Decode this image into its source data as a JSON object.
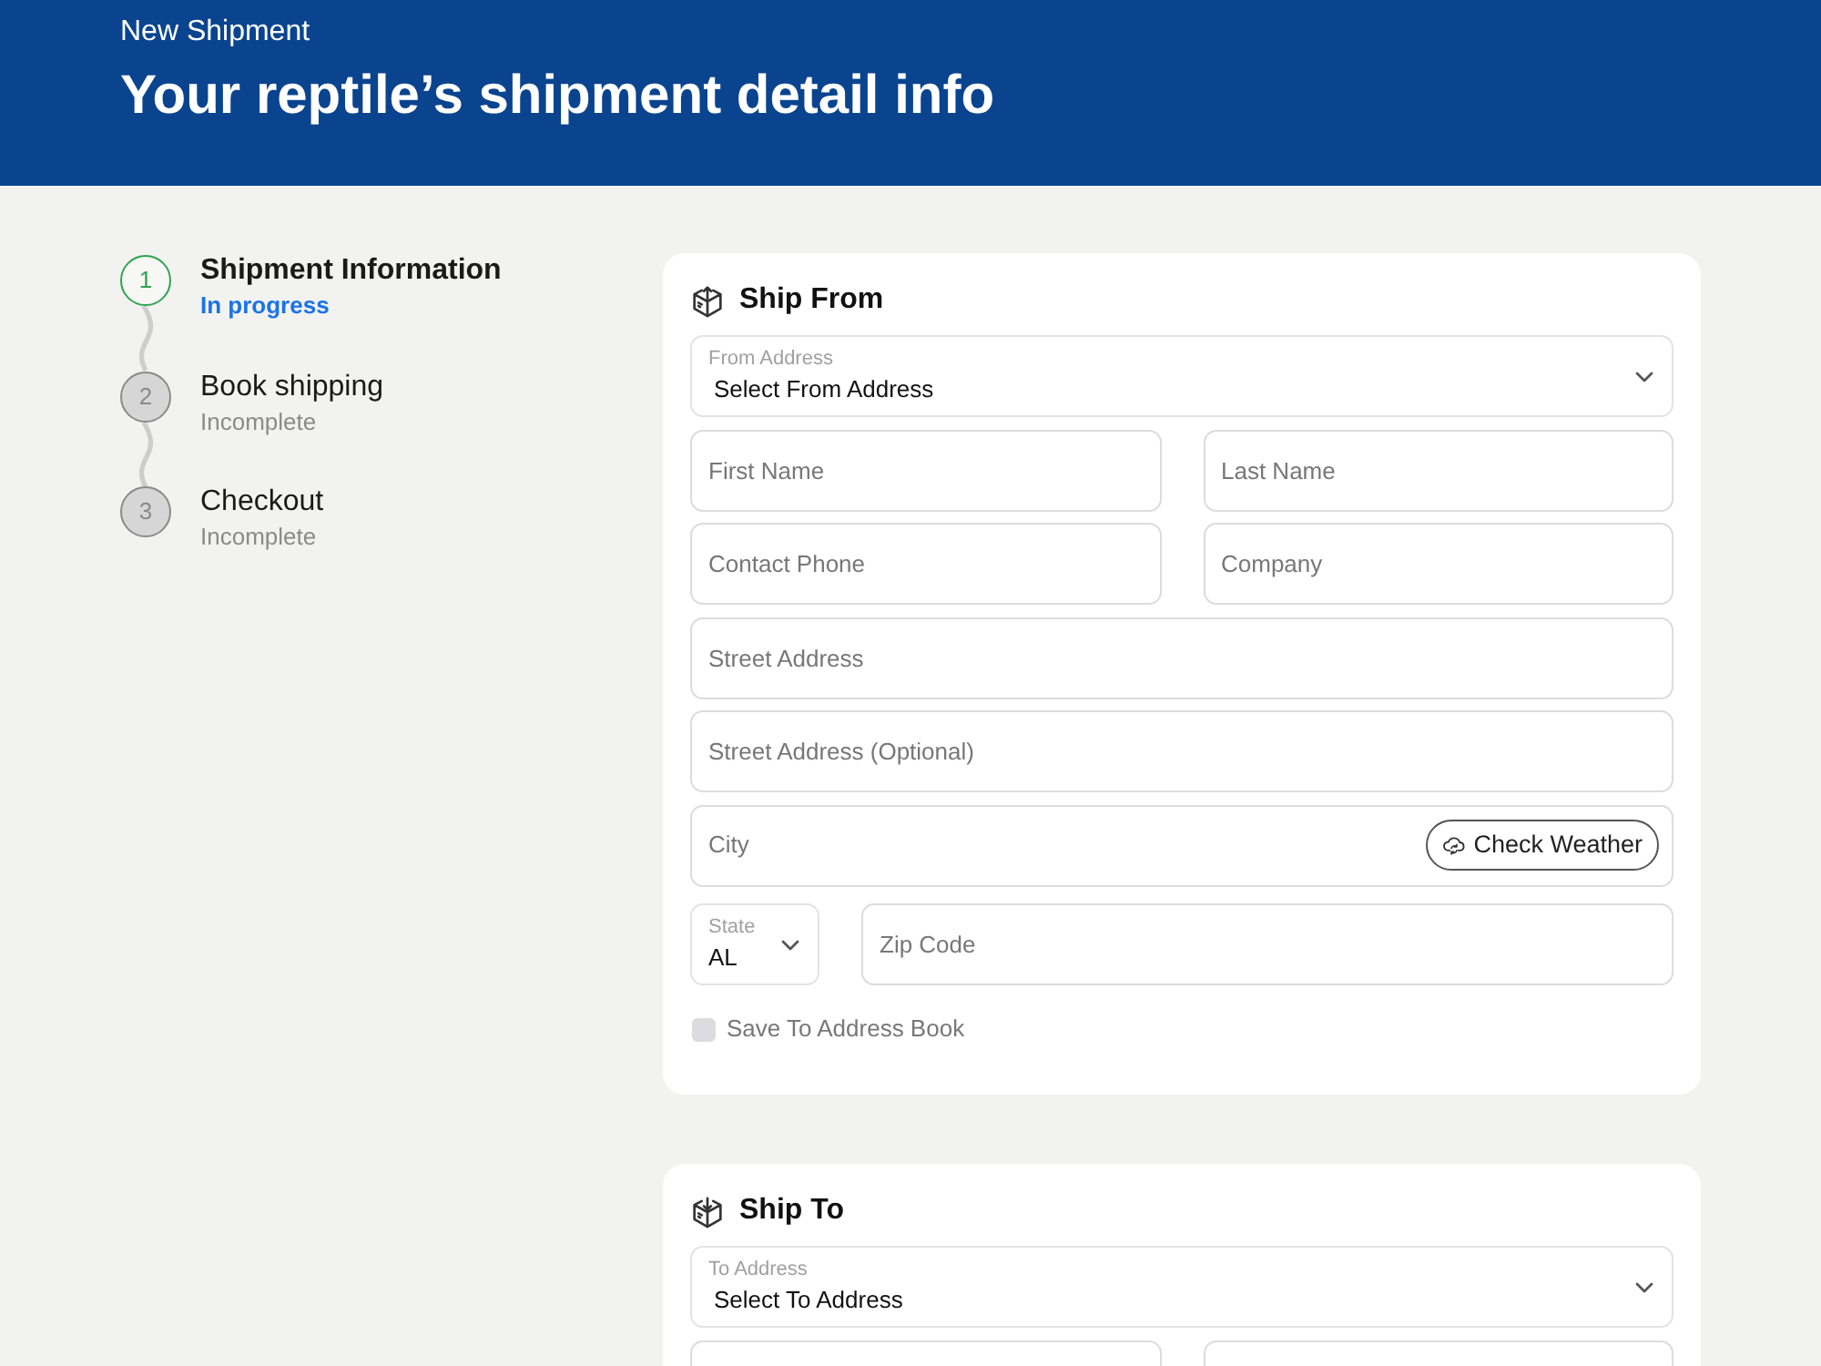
{
  "header": {
    "subtitle": "New Shipment",
    "title": "Your reptile’s shipment detail info"
  },
  "steps": [
    {
      "number": "1",
      "title": "Shipment Information",
      "status": "In progress",
      "active": true
    },
    {
      "number": "2",
      "title": "Book shipping",
      "status": "Incomplete",
      "active": false
    },
    {
      "number": "3",
      "title": "Checkout",
      "status": "Incomplete",
      "active": false
    }
  ],
  "ship_from": {
    "title": "Ship From",
    "rows": [
      [
        {
          "kind": "select",
          "label": "From Address",
          "value": "Select From Address"
        }
      ],
      [
        {
          "kind": "text",
          "placeholder": "First Name"
        },
        {
          "kind": "text",
          "placeholder": "Last Name"
        }
      ],
      [
        {
          "kind": "text",
          "placeholder": "Contact Phone"
        },
        {
          "kind": "text",
          "placeholder": "Company"
        }
      ],
      [
        {
          "kind": "text",
          "placeholder": "Street Address"
        }
      ],
      [
        {
          "kind": "text",
          "placeholder": "Street Address (Optional)"
        }
      ],
      [
        {
          "kind": "text",
          "placeholder": "City",
          "button": "Check Weather"
        }
      ],
      [
        {
          "kind": "select",
          "label": "State",
          "value": "AL"
        },
        {
          "kind": "text",
          "placeholder": "Zip Code"
        }
      ]
    ],
    "checkbox": {
      "label": "Save To Address Book",
      "checked": false
    }
  },
  "ship_to": {
    "title": "Ship To",
    "rows": [
      [
        {
          "kind": "select",
          "label": "To Address",
          "value": "Select To Address"
        }
      ],
      [
        {
          "kind": "text"
        },
        {
          "kind": "text"
        }
      ]
    ]
  }
}
